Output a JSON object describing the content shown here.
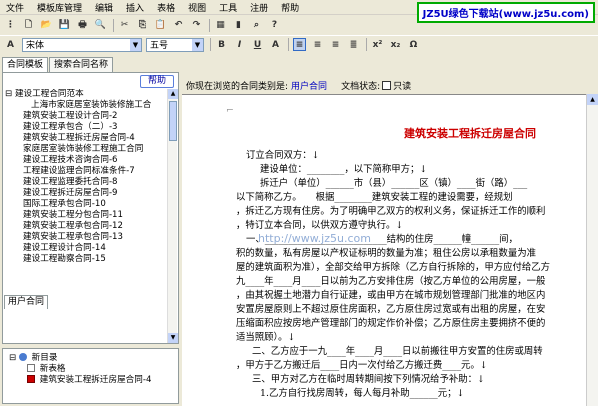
{
  "menu": [
    "文件",
    "模板库管理",
    "编辑",
    "插入",
    "表格",
    "视图",
    "工具",
    "注册",
    "帮助"
  ],
  "brand": "JZ5U绿色下载站(www.jz5u.com)",
  "format": {
    "font_name": "宋体",
    "font_size": "五号",
    "bold": "B",
    "italic": "I",
    "underline": "U"
  },
  "left": {
    "tabs": [
      "合同模板",
      "搜索合同名称"
    ],
    "help_button": "帮助",
    "tree_root": "建设工程合同范本",
    "tree_items": [
      "上海市家庭居室装饰装修施工合",
      "建筑安装工程设计合同-2",
      "建设工程承包合（二）-3",
      "建筑安装工程拆迁房屋合同-4",
      "家庭居室装饰装修工程施工合同",
      "建设工程技术咨询合同-6",
      "工程建设监理合同标准条件-7",
      "建设工程监理委托合同-8",
      "建设工程拆迁房屋合同-9",
      "国际工程承包合同-10",
      "建筑安装工程分包合同-11",
      "建筑安装工程承包合同-12",
      "建筑安装工程承包合同-13",
      "建设工程设计合同-14",
      "建设工程勘察合同-15"
    ],
    "user_tab": "用户合同",
    "user_tree": {
      "root": "新目录",
      "items": [
        "新表格",
        "建筑安装工程拆迁房屋合同-4"
      ]
    }
  },
  "browse": {
    "label": "你现在浏览的合同类别是:",
    "category": "用户合同",
    "status_label": "文档状态:",
    "readonly": "只读"
  },
  "doc": {
    "title": "建筑安装工程拆迁房屋合同",
    "lines": [
      "订立合同双方：↓",
      "建设单位：________，以下简称甲方；↓",
      "拆迁户（单位）______市（县）______区（镇）____街（路）___",
      "以下简称乙方。　　根据________建筑安装工程的建设需要，经规划",
      "，拆迁乙方现有住房。为了明确甲乙双方的权利义务，保证拆迁工作的顺利",
      "，特订立本合同，以供双方遵守执行。↓",
      "一、__________________________结构的住房______幢______间，",
      "积的数量，私有房屋以产权证标明的数量为准；租住公房以承租数量为准",
      "屋的建筑面积为准），全部交给甲方拆除（乙方自行拆除的，甲方应付给乙方",
      "九____年____月____日以前为乙方安排住房（按乙方单位的公用房屋，一般",
      "，由其祝握土地潜力自行证建，或由甲方在城市规划管理部门批准的地区内",
      "安置房屋原则上不超过原住房面积，乙方原住房过宽或有出租的房屋，在安",
      "压缩面积应按房地产管理部门的规定作价补偿；乙方原住房主要拥挤不便的",
      "适当照顾）。↓",
      "二、乙方应于一九____年____月____日以前搬往甲方安置的住房或周转",
      "，甲方于乙方搬迁后____日内一次付给乙方搬迁费____元。↓",
      "三、甲方对乙方在临时周转期间按下列情况给予补助：↓",
      "1.乙方自行找房周转，每人每月补助______元；↓"
    ]
  },
  "watermark": "http://www.jz5u.com"
}
